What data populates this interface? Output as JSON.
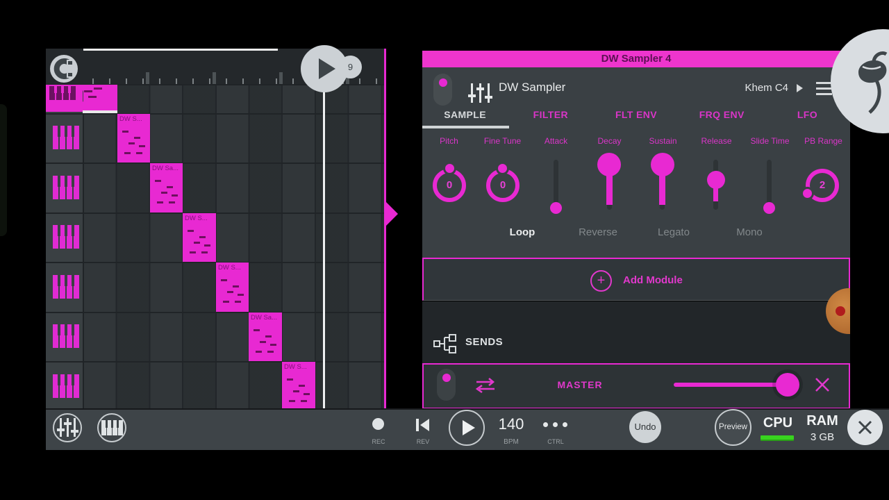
{
  "overlay": {
    "playhead_badge": "9"
  },
  "playlist": {
    "clips": [
      {
        "label": "DW S..."
      },
      {
        "label": "DW Sa..."
      },
      {
        "label": "DW S..."
      },
      {
        "label": "DW S..."
      },
      {
        "label": "DW Sa..."
      },
      {
        "label": "DW S..."
      }
    ]
  },
  "panel": {
    "window_title": "DW Sampler 4",
    "instrument_name": "DW Sampler",
    "preset_name": "Khem C4",
    "tabs": [
      {
        "label": "SAMPLE"
      },
      {
        "label": "FILTER"
      },
      {
        "label": "FLT ENV"
      },
      {
        "label": "FRQ ENV"
      },
      {
        "label": "LFO"
      }
    ],
    "params": [
      {
        "label": "Pitch",
        "value": "0"
      },
      {
        "label": "Fine Tune",
        "value": "0"
      },
      {
        "label": "Attack"
      },
      {
        "label": "Decay"
      },
      {
        "label": "Sustain"
      },
      {
        "label": "Release"
      },
      {
        "label": "Slide Time"
      },
      {
        "label": "PB Range",
        "value": "2"
      }
    ],
    "toggles": [
      {
        "label": "Loop"
      },
      {
        "label": "Reverse"
      },
      {
        "label": "Legato"
      },
      {
        "label": "Mono"
      }
    ],
    "add_module_label": "Add Module",
    "plus_glyph": "+",
    "sends_label": "SENDS",
    "master_label": "MASTER"
  },
  "toolbar": {
    "rec_label": "REC",
    "rev_label": "REV",
    "bpm_value": "140",
    "bpm_label": "BPM",
    "ctrl_label": "CTRL",
    "undo_label": "Undo",
    "preview_label": "Preview",
    "cpu_label": "CPU",
    "ram_label": "RAM",
    "ram_value": "3 GB"
  },
  "colors": {
    "accent": "#e829d2",
    "cpu_meter_green": "#38d31f"
  }
}
